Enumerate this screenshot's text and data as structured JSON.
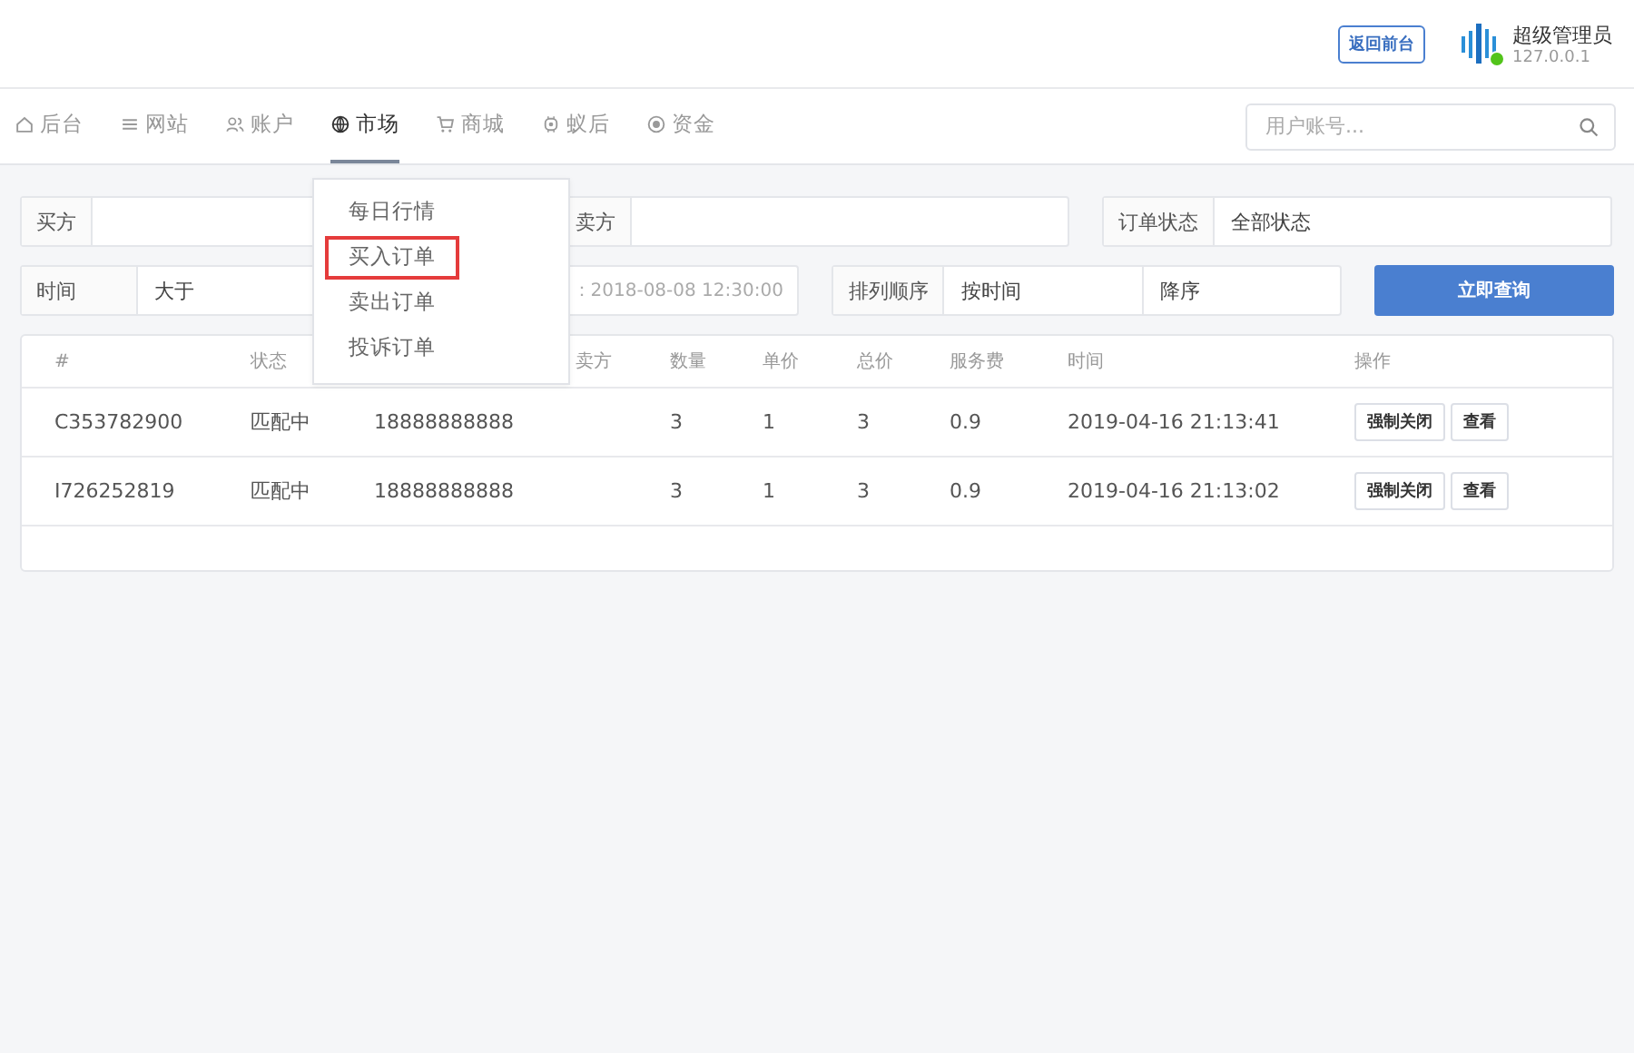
{
  "header": {
    "front_button": "返回前台",
    "user": {
      "name": "超级管理员",
      "ip": "127.0.0.1",
      "online": true
    }
  },
  "nav": {
    "items": [
      {
        "kind": "home",
        "label": "后台",
        "selected": false
      },
      {
        "kind": "list",
        "label": "网站",
        "selected": false
      },
      {
        "kind": "users",
        "label": "账户",
        "selected": false
      },
      {
        "kind": "globe",
        "label": "市场",
        "selected": true
      },
      {
        "kind": "cart",
        "label": "商城",
        "selected": false
      },
      {
        "kind": "bug",
        "label": "蚁后",
        "selected": false
      },
      {
        "kind": "coin",
        "label": "资金",
        "selected": false
      }
    ],
    "search": {
      "placeholder": "用户账号..."
    }
  },
  "market_menu": {
    "items": [
      {
        "label": "每日行情",
        "selected": false
      },
      {
        "label": "买入订单",
        "selected": true
      },
      {
        "label": "卖出订单",
        "selected": false
      },
      {
        "label": "投诉订单",
        "selected": false
      }
    ]
  },
  "filters": {
    "buyer": {
      "label": "买方"
    },
    "seller": {
      "label": "卖方"
    },
    "status": {
      "label": "订单状态",
      "value": "全部状态"
    },
    "time": {
      "label": "时间",
      "operator": "大于",
      "placeholder": "：2018-08-08 12:30:00"
    },
    "sort": {
      "label": "排列顺序",
      "field": "按时间",
      "direction": "降序"
    },
    "query_button": "立即查询"
  },
  "table": {
    "columns": [
      "#",
      "状态",
      "",
      "卖方",
      "数量",
      "单价",
      "总价",
      "服务费",
      "时间",
      "操作"
    ],
    "rows": [
      {
        "cells": [
          "C353782900",
          "匹配中",
          "18888888888",
          "",
          "3",
          "1",
          "3",
          "0.9",
          "2019-04-16 21:13:41"
        ],
        "actions": [
          "强制关闭",
          "查看"
        ]
      },
      {
        "cells": [
          "I726252819",
          "匹配中",
          "18888888888",
          "",
          "3",
          "1",
          "3",
          "0.9",
          "2019-04-16 21:13:02"
        ],
        "actions": [
          "强制关闭",
          "查看"
        ]
      }
    ]
  }
}
